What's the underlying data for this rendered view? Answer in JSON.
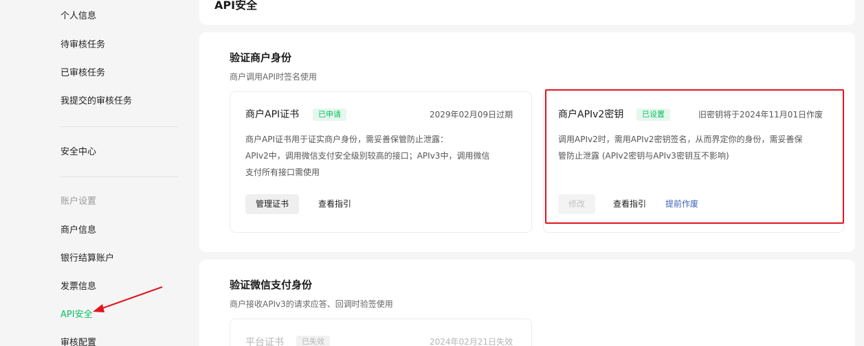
{
  "sidebar": {
    "items": [
      {
        "label": "个人信息"
      },
      {
        "label": "待审核任务"
      },
      {
        "label": "已审核任务"
      },
      {
        "label": "我提交的审核任务"
      },
      {
        "label": "安全中心"
      },
      {
        "label": "账户设置"
      },
      {
        "label": "商户信息"
      },
      {
        "label": "银行结算账户"
      },
      {
        "label": "发票信息"
      },
      {
        "label": "API安全"
      },
      {
        "label": "审核配置"
      }
    ],
    "active_color": "#07c160"
  },
  "page": {
    "title": "API安全"
  },
  "merchant_section": {
    "title": "验证商户身份",
    "subtitle": "商户调用API时签名使用",
    "cert_card": {
      "title": "商户API证书",
      "badge": "已申请",
      "expiry": "2029年02月09日过期",
      "desc_line1": "商户API证书用于证实商户身份，需妥善保管防止泄露：",
      "desc_line2": "APIv2中，调用微信支付安全级别较高的接口；APIv3中，调用微信",
      "desc_line3": "支付所有接口需使用",
      "manage_button": "管理证书",
      "guide_link": "查看指引"
    },
    "key_card": {
      "title": "商户APIv2密钥",
      "badge": "已设置",
      "notice": "旧密钥将于2024年11月01日作废",
      "desc_line1": "调用APIv2时，需用APIv2密钥签名，从而界定你的身份，需妥善保",
      "desc_line2": "管防止泄露 (APIv2密钥与APIv3密钥互不影响)",
      "modify_button": "修改",
      "guide_link": "查看指引",
      "revoke_link": "提前作废"
    }
  },
  "wechat_section": {
    "title": "验证微信支付身份",
    "subtitle": "商户接收APIv3的请求应答、回调时验签使用",
    "platform_card": {
      "title": "平台证书",
      "badge": "已失效",
      "expiry": "2024年02月21日失效"
    }
  },
  "annotation": {
    "highlight_color": "#e1141e"
  }
}
